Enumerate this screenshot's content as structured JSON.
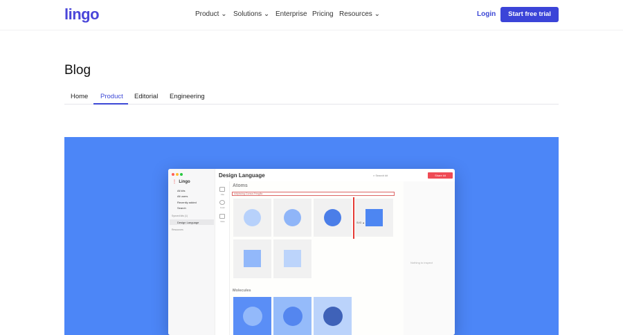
{
  "header": {
    "logo": "lingo",
    "nav": [
      {
        "label": "Product",
        "dropdown": true
      },
      {
        "label": "Solutions",
        "dropdown": true
      },
      {
        "label": "Enterprise"
      },
      {
        "label": "Pricing"
      },
      {
        "label": "Resources",
        "dropdown": true
      }
    ],
    "login": "Login",
    "cta": "Start free trial"
  },
  "page": {
    "title": "Blog",
    "tabs": [
      "Home",
      "Product",
      "Editorial",
      "Engineering"
    ],
    "active_tab": "Product"
  },
  "app": {
    "workspace": "Lingo",
    "sidebar": [
      "All kits",
      "All users",
      "Recently added",
      "Search"
    ],
    "synced_label": "Synced kits (1)",
    "kit": "Design Language",
    "resources": "Resources",
    "title": "Design Language",
    "search_placeholder": "Search kit",
    "share": "Share kit",
    "tools": [
      "File",
      "Color",
      "Note"
    ],
    "section1": "Atoms",
    "note": "Adipiscing Cursus Fringilla",
    "section2": "Molecules",
    "inspector": "Nothing to inspect",
    "drag_label": "SVG"
  },
  "colors": {
    "brand": "#3b44d8",
    "banner": "#4c86f7",
    "share": "#ef4b55"
  }
}
